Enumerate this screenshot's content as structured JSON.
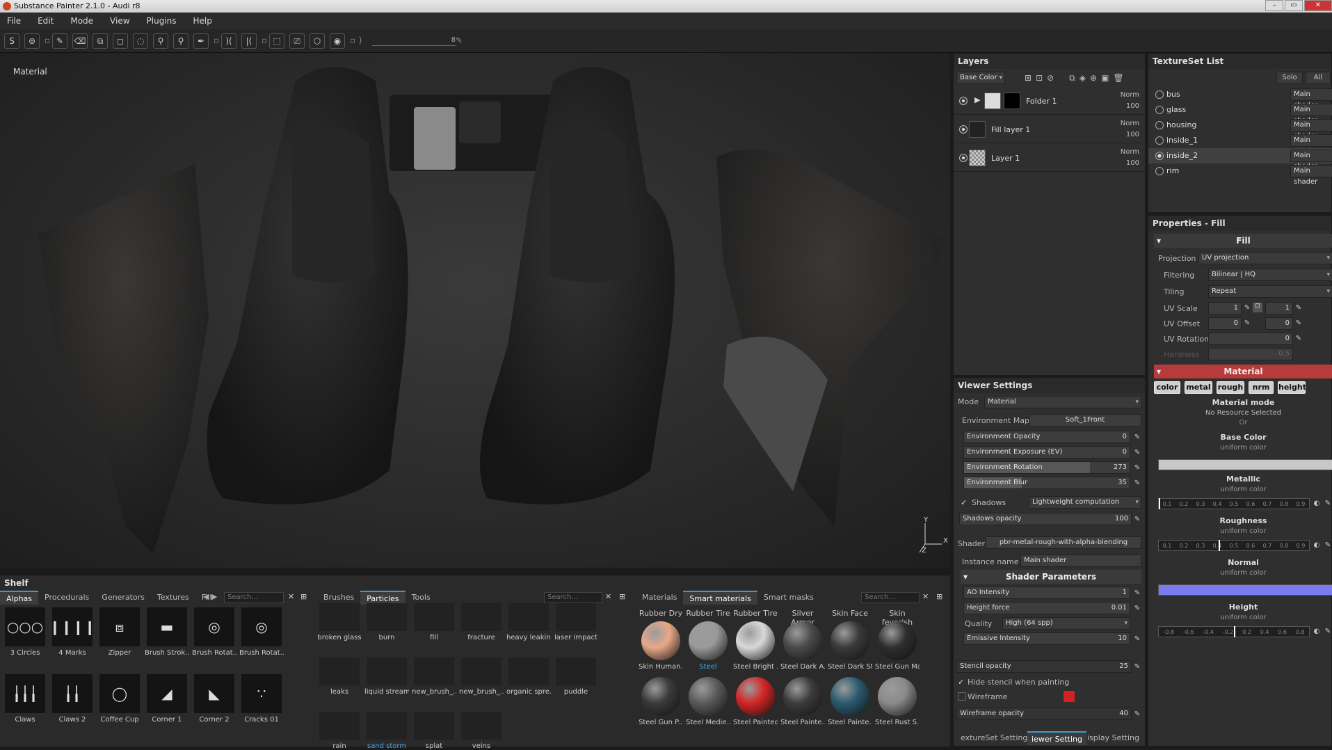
{
  "titlebar": {
    "title": "Substance Painter 2.1.0 - Audi r8",
    "min": "–",
    "max": "▭",
    "close": "✕"
  },
  "menu": [
    "File",
    "Edit",
    "Mode",
    "View",
    "Plugins",
    "Help"
  ],
  "toolbar": {
    "size_value": "8"
  },
  "viewport": {
    "mode_label": "Material",
    "axis": {
      "x": "X",
      "y": "Y",
      "z": "Z"
    }
  },
  "layers": {
    "title": "Layers",
    "channel": "Base Color",
    "items": [
      {
        "name": "Folder 1",
        "blend": "Norm",
        "opacity": "100"
      },
      {
        "name": "Fill layer 1",
        "blend": "Norm",
        "opacity": "100"
      },
      {
        "name": "Layer 1",
        "blend": "Norm",
        "opacity": "100"
      }
    ]
  },
  "textureset": {
    "title": "TextureSet List",
    "solo": "Solo",
    "all": "All",
    "items": [
      {
        "name": "bus",
        "shader": "Main shader"
      },
      {
        "name": "glass",
        "shader": "Main shader"
      },
      {
        "name": "housing",
        "shader": "Main shader"
      },
      {
        "name": "inside_1",
        "shader": "Main shader"
      },
      {
        "name": "inside_2",
        "shader": "Main shader"
      },
      {
        "name": "rim",
        "shader": "Main shader"
      }
    ]
  },
  "properties": {
    "title": "Properties - Fill",
    "fill_section": "Fill",
    "projection_label": "Projection",
    "projection": "UV projection",
    "filtering_label": "Filtering",
    "filtering": "Bilinear | HQ",
    "tiling_label": "Tiling",
    "tiling": "Repeat",
    "uvscale_label": "UV Scale",
    "uvscale_a": "1",
    "uvscale_b": "1",
    "uvoffset_label": "UV Offset",
    "uvoffset_a": "0",
    "uvoffset_b": "0",
    "uvrotation_label": "UV Rotation",
    "uvrotation": "0",
    "hardness_label": "Hardness",
    "hardness": "0.5",
    "material_section": "Material",
    "channels": [
      "color",
      "metal",
      "rough",
      "nrm",
      "height"
    ],
    "material_mode": "Material mode",
    "no_resource": "No Resource Selected",
    "or": "Or",
    "base_color": "Base Color",
    "metallic": "Metallic",
    "roughness": "Roughness",
    "normal": "Normal",
    "height": "Height",
    "uniform": "uniform color",
    "scale_ticks": [
      "0.1",
      "0.2",
      "0.3",
      "0.4",
      "0.5",
      "0.6",
      "0.7",
      "0.8",
      "0.9"
    ],
    "height_ticks": [
      "-0.8",
      "-0.6",
      "-0.4",
      "-0.2",
      "0.2",
      "0.4",
      "0.6",
      "0.8"
    ],
    "colors": {
      "base": "#c8c8c8",
      "normal": "#7b7bf0",
      "material_bar": "#b83a3a"
    },
    "levels": {
      "metallic": 0.0,
      "roughness": 0.4,
      "height": 0.5
    }
  },
  "viewer": {
    "title": "Viewer Settings",
    "mode_label": "Mode",
    "mode": "Material",
    "envmap_label": "Environment Map",
    "envmap": "Soft_1Front",
    "env_opacity_label": "Environment Opacity",
    "env_opacity": "0",
    "env_exposure_label": "Environment Exposure (EV)",
    "env_exposure": "0",
    "env_rotation_label": "Environment Rotation",
    "env_rotation": "273",
    "env_blur_label": "Environment Blur",
    "env_blur": "35",
    "shadows_label": "Shadows",
    "shadows_mode": "Lightweight computation",
    "shadows_opacity_label": "Shadows opacity",
    "shadows_opacity": "100",
    "shader_label": "Shader",
    "shader": "pbr-metal-rough-with-alpha-blending",
    "instance_label": "Instance name",
    "instance": "Main shader",
    "shader_params": "Shader Parameters",
    "ao_label": "AO Intensity",
    "ao": "1",
    "height_force_label": "Height force",
    "height_force": "0.01",
    "quality_label": "Quality",
    "quality": "High (64 spp)",
    "emissive_label": "Emissive Intensity",
    "emissive": "10",
    "stencil_label": "Stencil opacity",
    "stencil": "25",
    "hide_stencil_label": "Hide stencil when painting",
    "wireframe_label": "Wireframe",
    "wireframe_color": "#d42020",
    "wireframe_opacity_label": "Wireframe opacity",
    "wireframe_opacity": "40",
    "levels": {
      "env_rotation": 0.76,
      "env_blur": 0.35
    },
    "bottom_tabs": [
      "extureSet Setting",
      "iewer Setting",
      "isplay Setting"
    ]
  },
  "shelf": {
    "title": "Shelf",
    "tabs1": [
      "Alphas",
      "Procedurals",
      "Generators",
      "Textures",
      "Filt"
    ],
    "tabs2": [
      "Brushes",
      "Particles",
      "Tools"
    ],
    "tabs3": [
      "Materials",
      "Smart materials",
      "Smart masks"
    ],
    "search": "Search...",
    "alphas": [
      "3 Circles",
      "4 Marks",
      "Zipper",
      "Brush Strok...",
      "Brush Rotat...",
      "Brush Rotat...",
      "Claws",
      "Claws 2",
      "Coffee Cup",
      "Corner 1",
      "Corner 2",
      "Cracks 01"
    ],
    "alpha_glyphs": [
      "○○○",
      "❙❙❙❙",
      "⧈",
      "▬",
      "◎",
      "◎",
      "╽╽╽",
      "╽╽",
      "◯",
      "◢",
      "◣",
      "∵"
    ],
    "particles": [
      "broken glass",
      "burn",
      "fill",
      "fracture",
      "heavy leaking",
      "laser impact",
      "leaks",
      "liquid stream",
      "new_brush_...",
      "new_brush_...",
      "organic spre...",
      "puddle",
      "rain",
      "sand storm",
      "splat",
      "veins"
    ],
    "materials_top": [
      "Rubber Dry",
      "Rubber Tire",
      "Rubber Tire ...",
      "Silver Armor",
      "Skin Face",
      "Skin feverish"
    ],
    "materials_mid": [
      "Skin Human...",
      "Steel",
      "Steel Bright ...",
      "Steel Dark A...",
      "Steel Dark St...",
      "Steel Gun Mat"
    ],
    "materials_bot": [
      "Steel Gun P...",
      "Steel Medie...",
      "Steel Painted",
      "Steel Painte...",
      "Steel Painte...",
      "Steel Rust S..."
    ],
    "ball_colors_mid": [
      "#e8a888",
      "#9a9a9a",
      "#d8d8d8",
      "#4a4a4a",
      "#3a3a3a",
      "#2e2e2e"
    ],
    "ball_colors_bot": [
      "#3a3a3a",
      "#5a5a5a",
      "#d42525",
      "#3c3c3c",
      "#2a5a70",
      "#8a8a8a"
    ]
  }
}
